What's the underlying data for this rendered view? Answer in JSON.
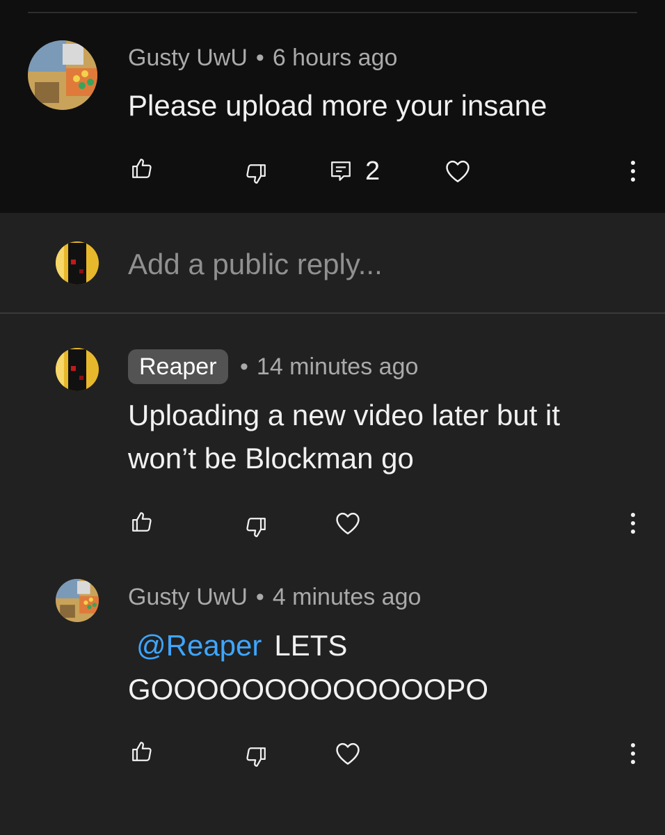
{
  "comment": {
    "author": "Gusty UwU",
    "time": "6 hours ago",
    "text": "Please upload more your insane",
    "reply_count": "2"
  },
  "reply_box": {
    "placeholder": "Add a public reply..."
  },
  "replies": [
    {
      "author": "Reaper",
      "time": "14 minutes ago",
      "text_line1": "Uploading a new video later but it",
      "text_line2": "won’t be Blockman go"
    },
    {
      "author": "Gusty UwU",
      "time": "4 minutes ago",
      "mention": "@Reaper",
      "text_line1": "LETS",
      "text_line2": "GOOOOOOOOOOOOOPO"
    }
  ],
  "separator": "•",
  "colors": {
    "top_background": "#0f0f0f",
    "background": "#212121",
    "mention": "#3ea6ff",
    "muted_text": "#aaaaaa"
  },
  "icons": {
    "like": "thumbs-up-icon",
    "dislike": "thumbs-down-icon",
    "replies": "comment-replies-icon",
    "heart": "heart-icon",
    "more": "more-vertical-icon"
  }
}
